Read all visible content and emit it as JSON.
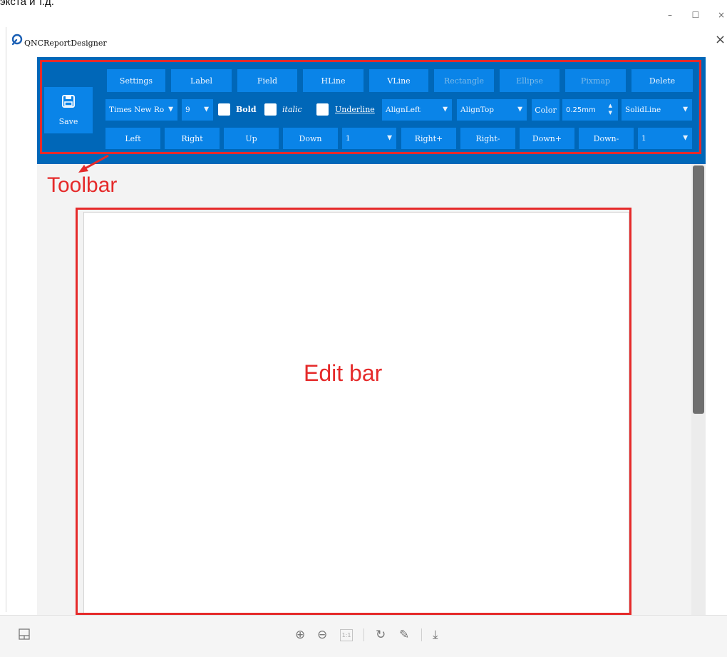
{
  "page_fragment": "экста и т.д.",
  "window_controls": {
    "minimize": "–",
    "maximize": "☐",
    "close": "×"
  },
  "app": {
    "title": "QNCReportDesigner",
    "close_glyph": "×"
  },
  "toolbar": {
    "save_label": "Save",
    "row1": [
      "Settings",
      "Label",
      "Field",
      "HLine",
      "VLine",
      "Rectangle",
      "Ellipse",
      "Pixmap",
      "Delete"
    ],
    "row1_disabled": [
      "Rectangle",
      "Ellipse",
      "Pixmap"
    ],
    "font_name": "Times New Ro",
    "font_size": "9",
    "bold_label": "Bold",
    "italic_label": "italic",
    "underline_label": "Underline",
    "align_h": "AlignLeft",
    "align_v": "AlignTop",
    "color_label": "Color",
    "line_width": "0.25mm",
    "line_style": "SolidLine",
    "row3": [
      "Left",
      "Right",
      "Up",
      "Down"
    ],
    "move_step": "1",
    "row3b": [
      "Right+",
      "Right-",
      "Down+",
      "Down-"
    ],
    "size_step": "1"
  },
  "annotations": {
    "toolbar": "Toolbar",
    "edit_bar": "Edit bar"
  },
  "bottom_bar": {
    "zoom_in": "⊕",
    "zoom_out": "⊖",
    "actual_size": "1:1",
    "rotate": "↻",
    "edit": "✎",
    "download": "⤓"
  },
  "colors": {
    "toolbar_bg": "#0067b8",
    "button_bg": "#0a84e8",
    "annotation": "#e52a2a"
  }
}
